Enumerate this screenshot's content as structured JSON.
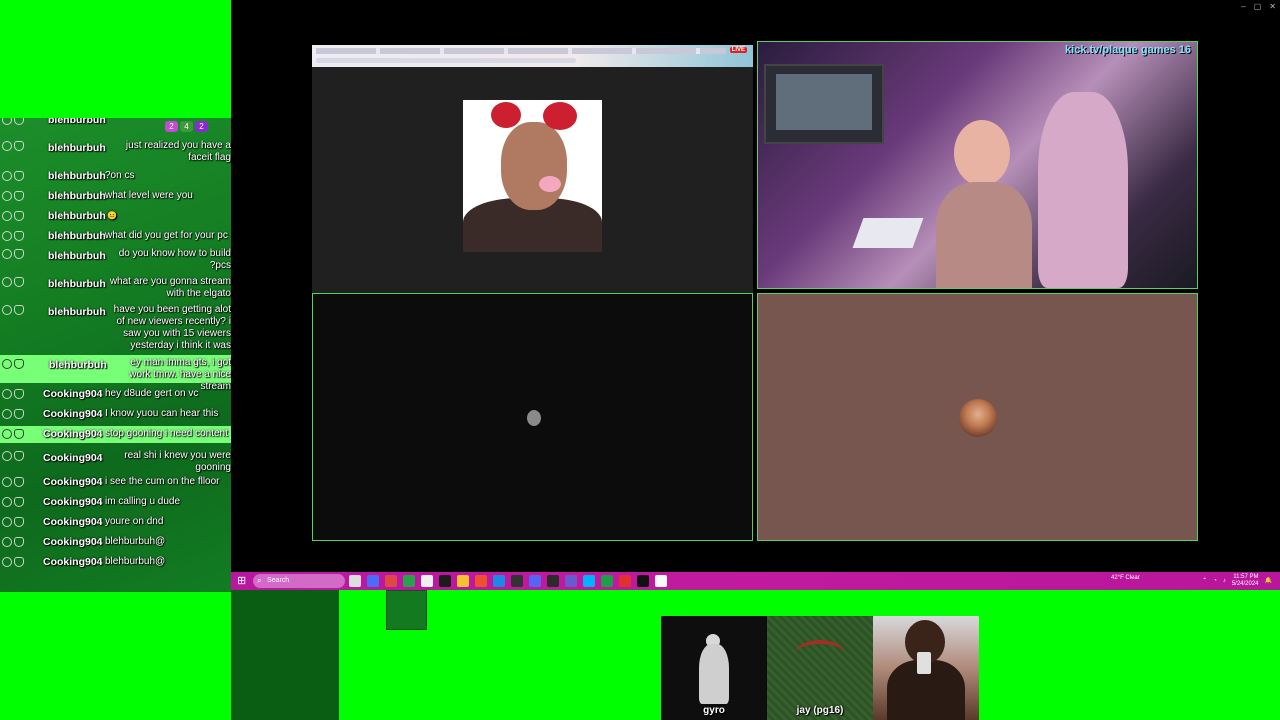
{
  "window": {
    "controls": [
      "–",
      "▢",
      "✕"
    ]
  },
  "chat": {
    "header_icons": [
      {
        "name": "play-icon",
        "label": "2",
        "color": "#c34bd1"
      },
      {
        "name": "badge-icon",
        "label": "4",
        "color": "#3c9a3c"
      },
      {
        "name": "chat-icon",
        "label": "2",
        "color": "#8a2bd1"
      }
    ],
    "messages": [
      {
        "user": "blehburbuh",
        "text": "",
        "top": 0
      },
      {
        "user": "blehburbuh",
        "text": "just realized you have a faceit flag"
      },
      {
        "user": "blehburbuh",
        "text": "?on cs"
      },
      {
        "user": "blehburbuh",
        "text": "what level were you"
      },
      {
        "user": "blehburbuh",
        "text": "😐"
      },
      {
        "user": "blehburbuh",
        "text": "what did you get for your pc"
      },
      {
        "user": "blehburbuh",
        "text": "do you know how to build ?pcs"
      },
      {
        "user": "blehburbuh",
        "text": "what are you gonna stream with the elgato"
      },
      {
        "user": "blehburbuh",
        "text": "have you been getting alot of new viewers recently? i saw you with 15 viewers yesterday i think it was"
      },
      {
        "user": "blehburbuh",
        "text": "ey man imma gts, i got work tmrw. have a nice stream",
        "highlight": true
      },
      {
        "user": "Cooking904",
        "text": "hey d8ude gert on vc"
      },
      {
        "user": "Cooking904",
        "text": "I know yuou can hear this"
      },
      {
        "user": "Cooking904",
        "text": "stop gooning i need content",
        "highlight": true
      },
      {
        "user": "Cooking904",
        "text": "real shi i knew you were gooning"
      },
      {
        "user": "Cooking904",
        "text": "i see the cum on the flloor"
      },
      {
        "user": "Cooking904",
        "text": "im calling u dude"
      },
      {
        "user": "Cooking904",
        "text": "youre on dnd"
      },
      {
        "user": "Cooking904",
        "text": "blehburbuh@"
      },
      {
        "user": "Cooking904",
        "text": "blehburbuh@"
      }
    ]
  },
  "stream": {
    "browser_live": "LIVE",
    "cam_overlay_text": "kick.tv/plaque games 16"
  },
  "taskbar": {
    "search_placeholder": "Search",
    "weather": "42°F Clear",
    "clock_time": "11:57 PM",
    "clock_date": "5/24/2024",
    "colors": {
      "bar": "#c11a9f"
    }
  },
  "participants": [
    {
      "name": "gyro"
    },
    {
      "name": "jay (pg16)"
    },
    {
      "name": ""
    }
  ]
}
